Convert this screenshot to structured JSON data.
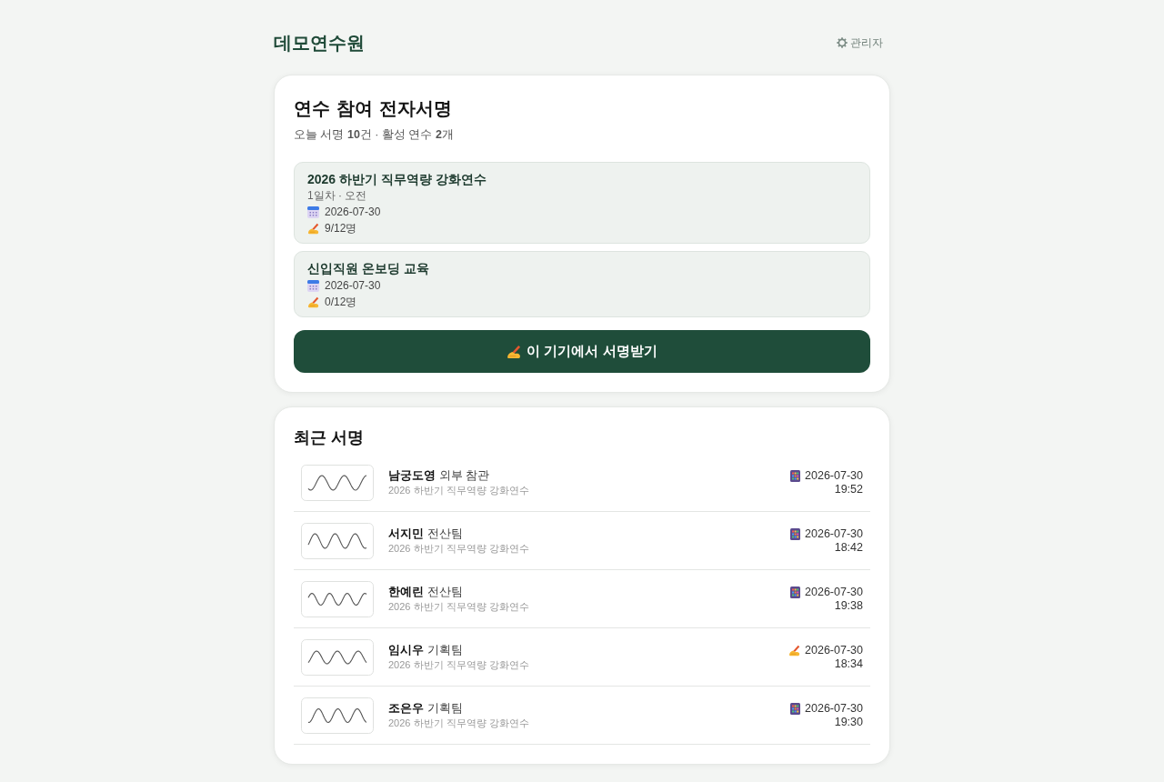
{
  "header": {
    "title": "데모연수원",
    "admin_link": "관리자"
  },
  "sign_panel": {
    "title": "연수 참여 전자서명",
    "summary": "오늘 서명 **10**건 · 활성 연수 **2**개",
    "courses": [
      {
        "title": "2026 하반기 직무역량 강화연수",
        "session": "1일차 · 오전",
        "date": "2026-07-30",
        "signed": "9/12명"
      },
      {
        "title": "신입직원 온보딩 교육",
        "date": "2026-07-30",
        "signed": "0/12명"
      }
    ],
    "sign_button": "이 기기에서 서명받기"
  },
  "recent": {
    "title": "최근 서명",
    "rows": [
      {
        "name": "남궁도영",
        "team": "외부 참관",
        "course": "2026 하반기 직무역량 강화연수",
        "kind": "tablet",
        "date": "2026-07-30",
        "time": "19:52"
      },
      {
        "name": "서지민",
        "team": "전산팀",
        "course": "2026 하반기 직무역량 강화연수",
        "kind": "tablet",
        "date": "2026-07-30",
        "time": "18:42"
      },
      {
        "name": "한예린",
        "team": "전산팀",
        "course": "2026 하반기 직무역량 강화연수",
        "kind": "tablet",
        "date": "2026-07-30",
        "time": "19:38"
      },
      {
        "name": "임시우",
        "team": "기획팀",
        "course": "2026 하반기 직무역량 강화연수",
        "kind": "pen",
        "date": "2026-07-30",
        "time": "18:34"
      },
      {
        "name": "조은우",
        "team": "기획팀",
        "course": "2026 하반기 직무역량 강화연수",
        "kind": "tablet",
        "date": "2026-07-30",
        "time": "19:30"
      }
    ]
  }
}
